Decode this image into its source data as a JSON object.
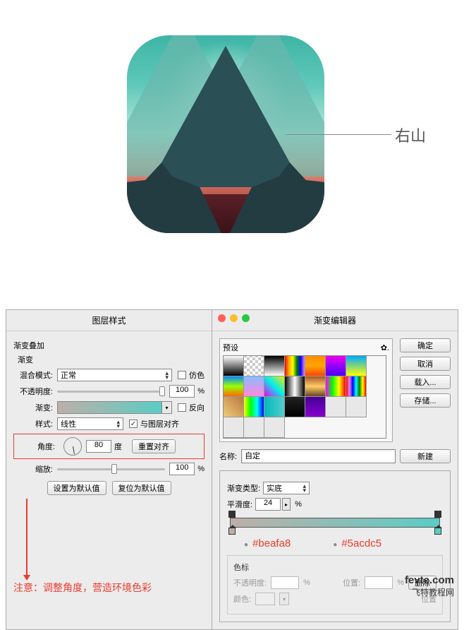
{
  "hero_label": "右山",
  "layer_style_panel": {
    "title": "图层样式",
    "section_overlay": "渐变叠加",
    "section_gradient": "渐变",
    "blend_label": "混合模式:",
    "blend_value": "正常",
    "dither_label": "仿色",
    "opacity_label": "不透明度:",
    "opacity_value": "100",
    "percent": "%",
    "gradient_label": "渐变:",
    "reverse_label": "反向",
    "style_label": "样式:",
    "style_value": "线性",
    "align_label": "与图层对齐",
    "align_checked": "✓",
    "angle_label": "角度:",
    "angle_value": "80",
    "angle_unit": "度",
    "reset_align_btn": "重置对齐",
    "scale_label": "缩放:",
    "scale_value": "100",
    "set_default_btn": "设置为默认值",
    "reset_default_btn": "复位为默认值",
    "note": "注意：调整角度，营造环境色彩"
  },
  "gradient_editor": {
    "title": "渐变编辑器",
    "presets_label": "预设",
    "gear_icon": "✿.",
    "ok_btn": "确定",
    "cancel_btn": "取消",
    "load_btn": "载入...",
    "save_btn": "存储...",
    "name_label": "名称:",
    "name_value": "自定",
    "new_btn": "新建",
    "type_label": "渐变类型:",
    "type_value": "实底",
    "smooth_label": "平滑度:",
    "smooth_value": "24",
    "hex_left": "#beafa8",
    "hex_right": "#5acdc5",
    "stops_label": "色标",
    "stop_opacity_label": "不透明度:",
    "stop_percent": "%",
    "stop_pos_label": "位置:",
    "delete_btn": "删除",
    "stop_color_label": "颜色:",
    "stop_pos2_label": "位置"
  },
  "watermark": {
    "domain": "fevte.com",
    "name": "飞特教程网"
  }
}
